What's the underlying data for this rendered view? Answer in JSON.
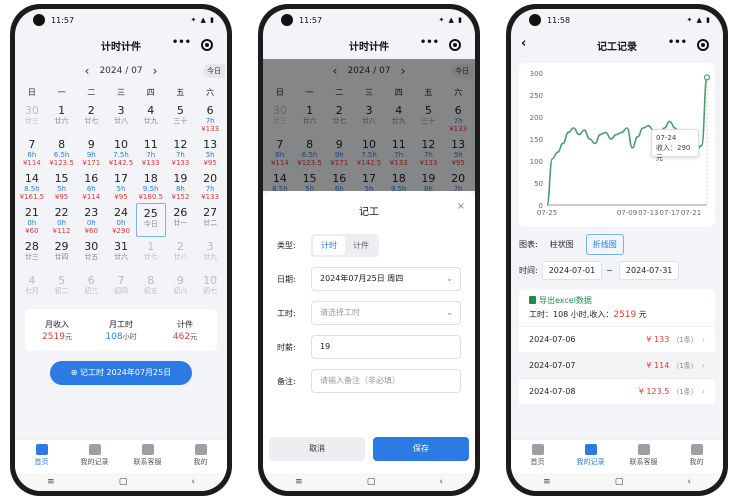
{
  "common": {
    "month_label": "2024 / 07",
    "today_btn": "今日",
    "weekdays": [
      "日",
      "一",
      "二",
      "三",
      "四",
      "五",
      "六"
    ],
    "nav": [
      "≡",
      "▢",
      "‹"
    ],
    "tabs": [
      {
        "label": "首页",
        "icon": "home-icon"
      },
      {
        "label": "我的记录",
        "icon": "list-icon"
      },
      {
        "label": "联系客服",
        "icon": "service-icon"
      },
      {
        "label": "我的",
        "icon": "user-icon"
      }
    ],
    "status_icons": "✦ ▲ ▮"
  },
  "screen1": {
    "time": "11:57",
    "title": "计时计件",
    "days": [
      {
        "d": "30",
        "s": "廿三",
        "o": true
      },
      {
        "d": "1",
        "s": "廿六"
      },
      {
        "d": "2",
        "s": "廿七"
      },
      {
        "d": "3",
        "s": "廿八"
      },
      {
        "d": "4",
        "s": "廿九"
      },
      {
        "d": "5",
        "s": "三十"
      },
      {
        "d": "6",
        "h": "7h",
        "m": "¥133"
      },
      {
        "d": "7",
        "h": "6h",
        "m": "¥114"
      },
      {
        "d": "8",
        "h": "6.5h",
        "m": "¥123.5"
      },
      {
        "d": "9",
        "h": "9h",
        "m": "¥171"
      },
      {
        "d": "10",
        "h": "7.5h",
        "m": "¥142.5"
      },
      {
        "d": "11",
        "h": "7h",
        "m": "¥133"
      },
      {
        "d": "12",
        "h": "7h",
        "m": "¥133"
      },
      {
        "d": "13",
        "h": "5h",
        "m": "¥95"
      },
      {
        "d": "14",
        "h": "8.5h",
        "m": "¥161.5"
      },
      {
        "d": "15",
        "h": "5h",
        "m": "¥95"
      },
      {
        "d": "16",
        "h": "6h",
        "m": "¥114"
      },
      {
        "d": "17",
        "h": "5h",
        "m": "¥95"
      },
      {
        "d": "18",
        "h": "9.5h",
        "m": "¥180.5"
      },
      {
        "d": "19",
        "h": "8h",
        "m": "¥152"
      },
      {
        "d": "20",
        "h": "7h",
        "m": "¥133"
      },
      {
        "d": "21",
        "h": "0h",
        "m": "¥60"
      },
      {
        "d": "22",
        "h": "0h",
        "m": "¥112"
      },
      {
        "d": "23",
        "h": "0h",
        "m": "¥60"
      },
      {
        "d": "24",
        "h": "0h",
        "m": "¥290"
      },
      {
        "d": "25",
        "s": "今日",
        "sel": true
      },
      {
        "d": "26",
        "s": "廿一"
      },
      {
        "d": "27",
        "s": "廿二"
      },
      {
        "d": "28",
        "s": "廿三"
      },
      {
        "d": "29",
        "s": "廿四"
      },
      {
        "d": "30",
        "s": "廿五"
      },
      {
        "d": "31",
        "s": "廿六"
      },
      {
        "d": "1",
        "s": "廿七",
        "o": true
      },
      {
        "d": "2",
        "s": "廿八",
        "o": true
      },
      {
        "d": "3",
        "s": "廿九",
        "o": true
      },
      {
        "d": "4",
        "s": "七月",
        "o": true
      },
      {
        "d": "5",
        "s": "初二",
        "o": true
      },
      {
        "d": "6",
        "s": "初三",
        "o": true
      },
      {
        "d": "7",
        "s": "初四",
        "o": true
      },
      {
        "d": "8",
        "s": "初五",
        "o": true
      },
      {
        "d": "9",
        "s": "初六",
        "o": true
      },
      {
        "d": "10",
        "s": "初七",
        "o": true
      }
    ],
    "summary": [
      {
        "label": "月收入",
        "value": "2519",
        "unit": "元",
        "color": "#e03b3b"
      },
      {
        "label": "月工时",
        "value": "108",
        "unit": "小时",
        "color": "#2a7de1"
      },
      {
        "label": "计件",
        "value": "462",
        "unit": "元",
        "color": "#e03b3b"
      }
    ],
    "record_button": "⊕ 记工时 2024年07月25日"
  },
  "screen2": {
    "time": "11:57",
    "title": "计时计件",
    "sheet_title": "记工",
    "close": "×",
    "type_label": "类型:",
    "type_options": [
      "计时",
      "计件"
    ],
    "date_label": "日期:",
    "date_value": "2024年07月25日  周四",
    "hours_label": "工时:",
    "hours_placeholder": "请选择工时",
    "wage_label": "时薪:",
    "wage_value": "19",
    "note_label": "备注:",
    "note_placeholder": "请输入备注（非必填）",
    "cancel": "取消",
    "save": "保存"
  },
  "screen3": {
    "time": "11:58",
    "title": "记工记录",
    "back": "‹",
    "tooltip": {
      "date": "07-24",
      "label": "收入：",
      "value": "290元"
    },
    "chart_type_label": "图表:",
    "chart_types": [
      "柱状图",
      "折线图"
    ],
    "time_label": "时间:",
    "date_from": "2024-07-01",
    "date_sep": "~",
    "date_to": "2024-07-31",
    "export_label": "导出excel数据",
    "stat_prefix": "工时：108 小时,收入：",
    "stat_income": "2519",
    "stat_suffix": " 元",
    "records": [
      {
        "date": "2024-07-06",
        "amount": "¥ 133",
        "count": "（1条）"
      },
      {
        "date": "2024-07-07",
        "amount": "¥ 114",
        "count": "（1条）"
      },
      {
        "date": "2024-07-08",
        "amount": "¥ 123.5",
        "count": "（1条）"
      }
    ]
  },
  "chart_data": {
    "type": "line",
    "x": [
      "07-25",
      "07-26",
      "07-27",
      "07-28",
      "07-29",
      "07-30",
      "07-31",
      "07-01",
      "07-02",
      "07-03",
      "07-04",
      "07-05",
      "07-06",
      "07-07",
      "07-08",
      "07-09",
      "07-10",
      "07-11",
      "07-12",
      "07-13",
      "07-14",
      "07-15",
      "07-16",
      "07-17",
      "07-18",
      "07-19",
      "07-20",
      "07-21",
      "07-22",
      "07-23",
      "07-24"
    ],
    "values": [
      0,
      105,
      120,
      140,
      165,
      175,
      160,
      170,
      150,
      140,
      160,
      165,
      150,
      160,
      165,
      175,
      130,
      155,
      175,
      180,
      170,
      155,
      175,
      190,
      175,
      160,
      155,
      140,
      125,
      135,
      290
    ],
    "xticks": [
      "07-25",
      "07-09",
      "07-13",
      "07-17",
      "07-21"
    ],
    "yticks": [
      0,
      50,
      100,
      150,
      200,
      250,
      300
    ],
    "ylim": [
      0,
      300
    ],
    "series_color": "#4c9a73"
  }
}
